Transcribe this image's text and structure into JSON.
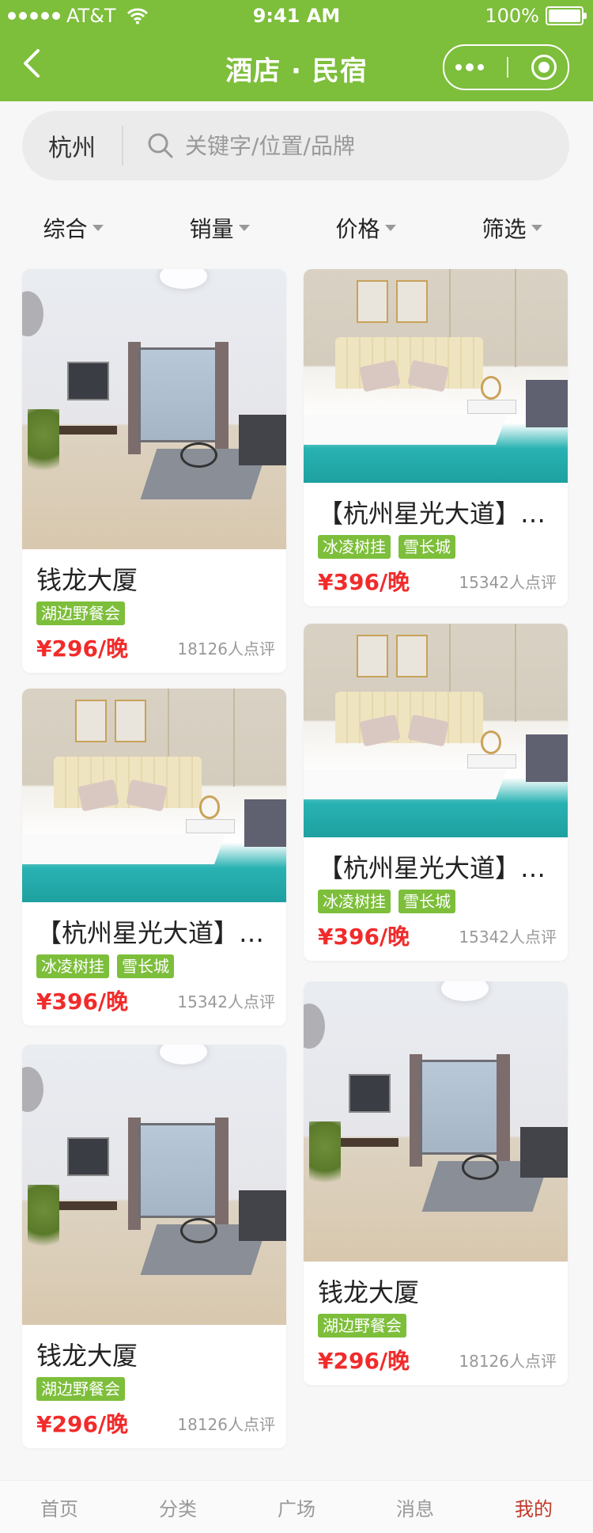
{
  "status_bar": {
    "carrier": "AT&T",
    "time": "9:41 AM",
    "battery": "100%"
  },
  "nav": {
    "title": "酒店 · 民宿"
  },
  "search": {
    "city": "杭州",
    "placeholder": "关键字/位置/品牌"
  },
  "filters": [
    "综合",
    "销量",
    "价格",
    "筛选"
  ],
  "cards": [
    {
      "title": "钱龙大厦",
      "tags": [
        "湖边野餐会"
      ],
      "price": "¥296/晚",
      "reviews": "18126人点评",
      "photo": "living-room-photo"
    },
    {
      "title": "【杭州星光大道】…",
      "tags": [
        "冰凌树挂",
        "雪长城"
      ],
      "price": "¥396/晚",
      "reviews": "15342人点评",
      "photo": "bedroom-photo"
    },
    {
      "title": "【杭州星光大道】…",
      "tags": [
        "冰凌树挂",
        "雪长城"
      ],
      "price": "¥396/晚",
      "reviews": "15342人点评",
      "photo": "bedroom-photo"
    },
    {
      "title": "【杭州星光大道】…",
      "tags": [
        "冰凌树挂",
        "雪长城"
      ],
      "price": "¥396/晚",
      "reviews": "15342人点评",
      "photo": "bedroom-photo"
    },
    {
      "title": "钱龙大厦",
      "tags": [
        "湖边野餐会"
      ],
      "price": "¥296/晚",
      "reviews": "18126人点评",
      "photo": "living-room-photo"
    },
    {
      "title": "钱龙大厦",
      "tags": [
        "湖边野餐会"
      ],
      "price": "¥296/晚",
      "reviews": "18126人点评",
      "photo": "living-room-photo"
    }
  ],
  "tabbar": [
    {
      "label": "首页",
      "active": false
    },
    {
      "label": "分类",
      "active": false
    },
    {
      "label": "广场",
      "active": false
    },
    {
      "label": "消息",
      "active": false
    },
    {
      "label": "我的",
      "active": true
    }
  ],
  "colors": {
    "brand": "#7dbe3b",
    "price": "#f12b2b",
    "tab_active": "#c0392b"
  }
}
